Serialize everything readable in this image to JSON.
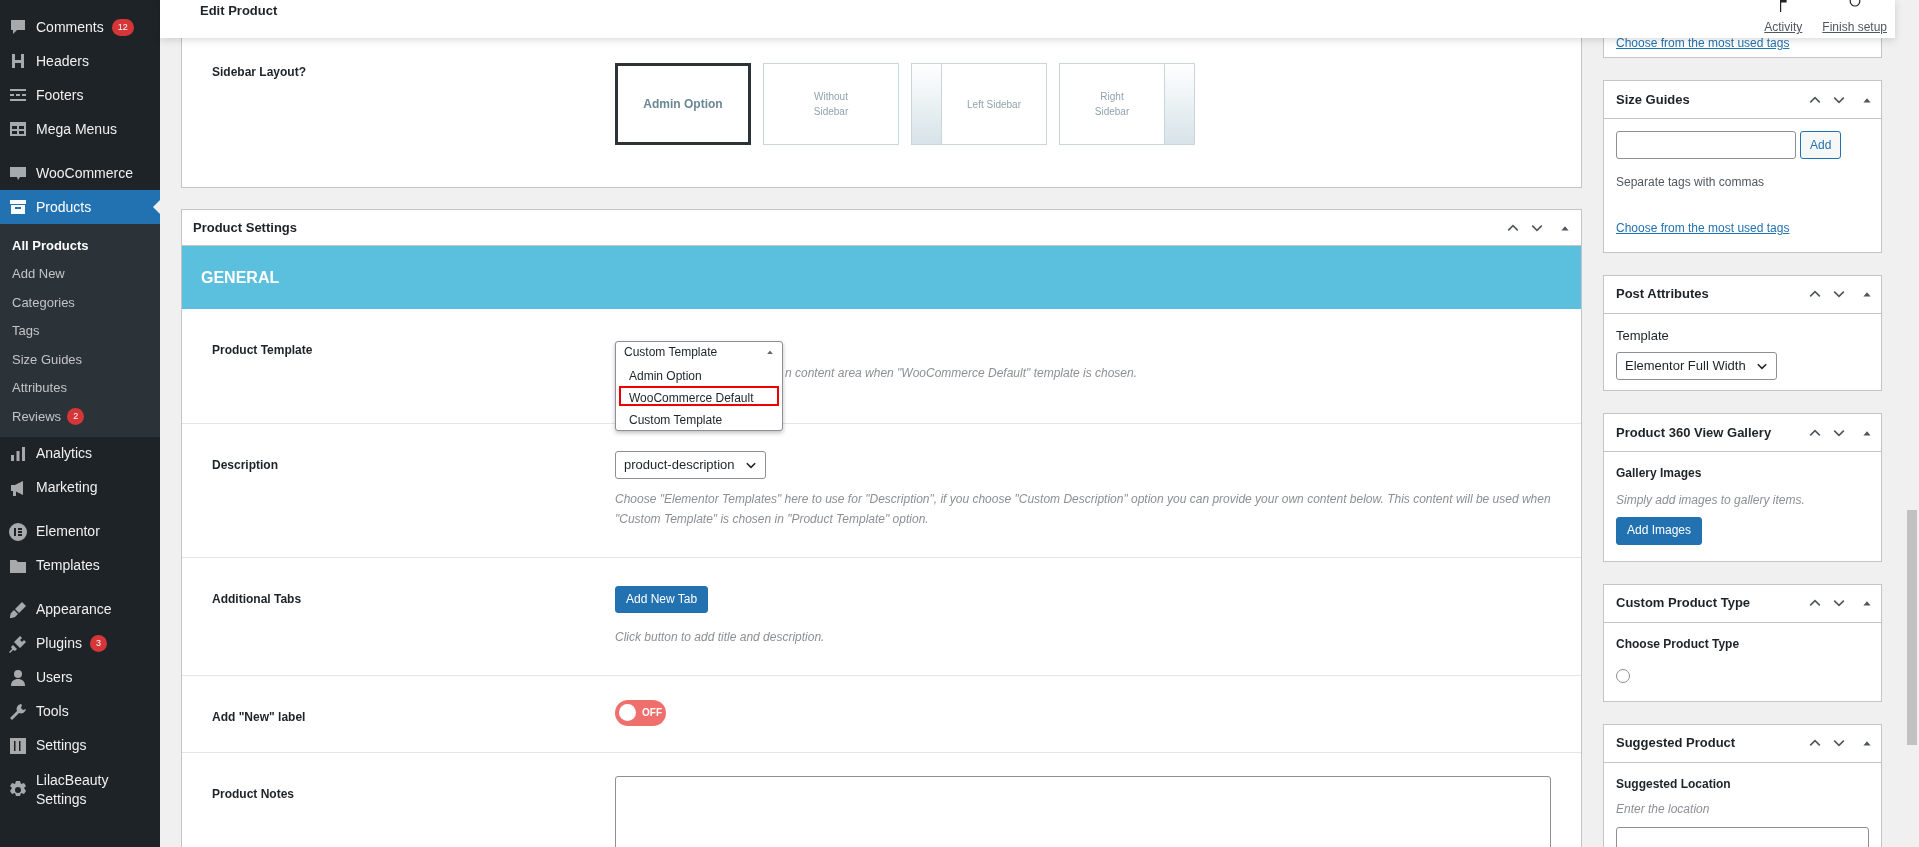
{
  "admin_menu": {
    "groups": [
      {
        "items": [
          {
            "label": "Comments",
            "badge": "12",
            "selected": false
          },
          {
            "label": "Headers",
            "selected": false
          },
          {
            "label": "Footers",
            "selected": false
          },
          {
            "label": "Mega Menus",
            "selected": false
          }
        ]
      },
      {
        "items": [
          {
            "label": "WooCommerce",
            "selected": false
          },
          {
            "label": "Products",
            "selected": true,
            "children": [
              {
                "label": "All Products",
                "selected": true
              },
              {
                "label": "Add New",
                "selected": false
              },
              {
                "label": "Categories",
                "selected": false
              },
              {
                "label": "Tags",
                "selected": false
              },
              {
                "label": "Size Guides",
                "selected": false
              },
              {
                "label": "Attributes",
                "selected": false
              },
              {
                "label": "Reviews",
                "badge": "2",
                "selected": false
              }
            ]
          },
          {
            "label": "Analytics",
            "selected": false
          },
          {
            "label": "Marketing",
            "selected": false
          }
        ]
      },
      {
        "items": [
          {
            "label": "Elementor",
            "selected": false
          },
          {
            "label": "Templates",
            "selected": false
          }
        ]
      },
      {
        "items": [
          {
            "label": "Appearance",
            "selected": false
          },
          {
            "label": "Plugins",
            "badge": "3",
            "selected": false
          },
          {
            "label": "Users",
            "selected": false
          },
          {
            "label": "Tools",
            "selected": false
          },
          {
            "label": "Settings",
            "selected": false
          }
        ]
      },
      {
        "items": [
          {
            "label": "LilacBeauty Settings",
            "selected": false
          }
        ]
      }
    ]
  },
  "header": {
    "title": "Edit Product",
    "actions": [
      "Activity",
      "Finish setup"
    ]
  },
  "sidebar_layout": {
    "label": "Sidebar Layout?",
    "options": [
      {
        "kind": "plain",
        "label": "Admin Option",
        "selected": true
      },
      {
        "kind": "none",
        "label": "Without Sidebar",
        "selected": false
      },
      {
        "kind": "left",
        "label": "Left Sidebar",
        "selected": false
      },
      {
        "kind": "right",
        "label": "Right Sidebar",
        "selected": false
      }
    ]
  },
  "product_settings": {
    "title": "Product Settings",
    "section": "GENERAL",
    "rows": [
      {
        "kind": "dropdown",
        "label": "Product Template",
        "value": "Custom Template",
        "expanded": true,
        "options": [
          {
            "label": "Admin Option",
            "outlined": false
          },
          {
            "label": "WooCommerce Default",
            "outlined": true
          },
          {
            "label": "Custom Template",
            "outlined": false
          }
        ],
        "help": "n content area when \"WooCommerce Default\" template is chosen."
      },
      {
        "kind": "select",
        "label": "Description",
        "value": "product-description",
        "help": "Choose \"Elementor Templates\" here to use for \"Description\", if you choose \"Custom Description\" option you can provide your own content below. This content will be used when \"Custom Template\" is chosen in \"Product Template\" option."
      },
      {
        "kind": "button",
        "label": "Additional Tabs",
        "button": "Add New Tab",
        "help": "Click button to add title and description."
      },
      {
        "kind": "toggle",
        "label": "Add \"New\" label",
        "on": false,
        "toggle_text": "OFF"
      },
      {
        "kind": "textarea",
        "label": "Product Notes"
      }
    ]
  },
  "side_boxes": [
    {
      "kind": "tags-tail",
      "link": "Choose from the most used tags"
    },
    {
      "kind": "tags",
      "title": "Size Guides",
      "button": "Add",
      "hint": "Separate tags with commas",
      "link": "Choose from the most used tags"
    },
    {
      "kind": "select",
      "title": "Post Attributes",
      "label": "Template",
      "value": "Elementor Full Width"
    },
    {
      "kind": "gallery",
      "title": "Product 360 View Gallery",
      "label": "Gallery Images",
      "hint": "Simply add images to gallery items.",
      "button": "Add Images"
    },
    {
      "kind": "radio",
      "title": "Custom Product Type",
      "label": "Choose Product Type",
      "checked": false
    },
    {
      "kind": "input",
      "title": "Suggested Product",
      "label": "Suggested Location",
      "hint": "Enter the location"
    }
  ]
}
